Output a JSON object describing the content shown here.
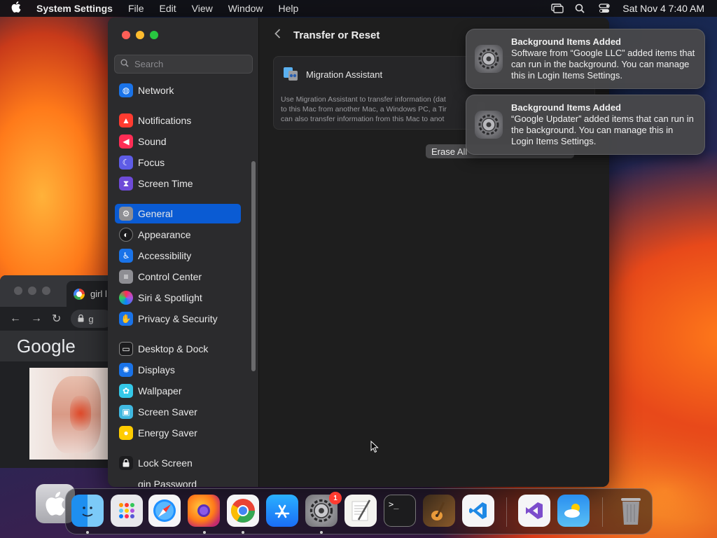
{
  "menubar": {
    "app_name": "System Settings",
    "menus": [
      "File",
      "Edit",
      "View",
      "Window",
      "Help"
    ],
    "datetime": "Sat Nov 4  7:40 AM"
  },
  "browser": {
    "tab_title": "girl l",
    "address": "g",
    "logo_text": "Google"
  },
  "settings": {
    "search_placeholder": "Search",
    "sidebar": {
      "network": "Network",
      "notifications": "Notifications",
      "sound": "Sound",
      "focus": "Focus",
      "screen_time": "Screen Time",
      "general": "General",
      "appearance": "Appearance",
      "accessibility": "Accessibility",
      "control_center": "Control Center",
      "siri": "Siri & Spotlight",
      "privacy": "Privacy & Security",
      "desktop_dock": "Desktop & Dock",
      "displays": "Displays",
      "wallpaper": "Wallpaper",
      "screen_saver": "Screen Saver",
      "energy_saver": "Energy Saver",
      "lock_screen": "Lock Screen",
      "login_password": "gin Password"
    },
    "header_title": "Transfer or Reset",
    "migration_title": "Migration Assistant",
    "migration_desc_1": "Use Migration Assistant to transfer information (dat",
    "migration_desc_2": "to this Mac from another Mac, a Windows PC, a Tir",
    "migration_desc_3": "can also transfer information from this Mac to anot",
    "erase_label": "Erase All"
  },
  "notifications": [
    {
      "title": "Background Items Added",
      "body": "Software from “Google LLC” added items that can run in the background. You can manage this in Login Items Settings."
    },
    {
      "title": "Background Items Added",
      "body": "“Google Updater” added items that can run in the background. You can manage this in Login Items Settings."
    }
  ],
  "dock": {
    "settings_badge": "1",
    "terminal_prompt": ">_"
  }
}
